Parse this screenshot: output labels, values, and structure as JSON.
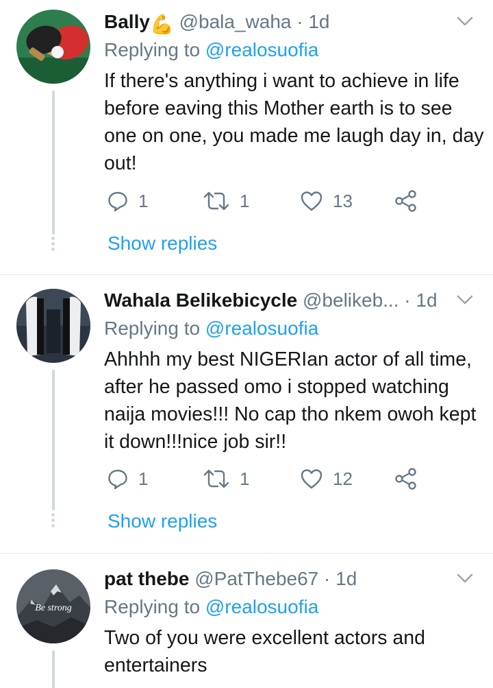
{
  "tweets": [
    {
      "name": "Bally",
      "name_emoji": "💪",
      "handle": "@bala_waha",
      "separator": "·",
      "time": "1d",
      "replying_prefix": "Replying to ",
      "replying_to": "@realosuofia",
      "text": "If there's anything i want to achieve in life before eaving this Mother earth is to see one on one, you made me laugh day in, day out!",
      "replies": "1",
      "retweets": "1",
      "likes": "13",
      "show_replies": "Show replies",
      "avatar_icon": "ping-pong-paddle-icon"
    },
    {
      "name": "Wahala Belikebicycle",
      "handle": "@belikeb...",
      "separator": "·",
      "time": "1d",
      "replying_prefix": "Replying to ",
      "replying_to": "@realosuofia",
      "text": "Ahhhh my best NIGERIan actor of all time, after he passed omo i stopped watching naija movies!!! No cap tho nkem owoh kept it down!!!nice job sir!!",
      "replies": "1",
      "retweets": "1",
      "likes": "12",
      "show_replies": "Show replies",
      "avatar_icon": "game-console-icon"
    },
    {
      "name": "pat thebe",
      "handle": "@PatThebe67",
      "separator": "·",
      "time": "1d",
      "replying_prefix": "Replying to ",
      "replying_to": "@realosuofia",
      "text": "Two of you were excellent actors and entertainers",
      "avatar_text": "Be strong",
      "avatar_icon": "mountain-icon"
    }
  ],
  "colors": {
    "link": "#1da1f2",
    "secondary": "#657786",
    "primary": "#14171a",
    "divider": "#e1e8ed"
  }
}
